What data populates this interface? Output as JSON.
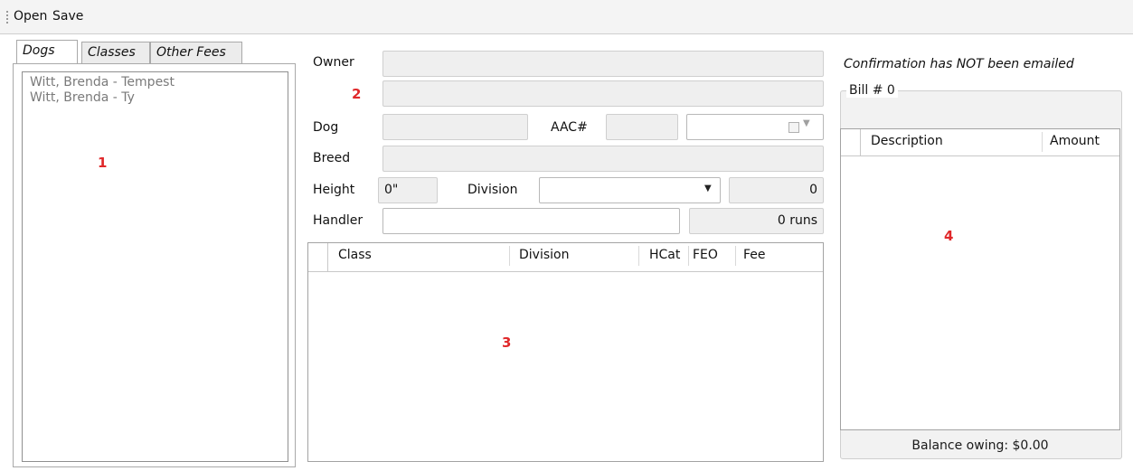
{
  "toolbar": {
    "open_label": "Open",
    "save_label": "Save"
  },
  "tabs": [
    {
      "label": "Dogs",
      "active": true
    },
    {
      "label": "Classes",
      "active": false
    },
    {
      "label": "Other Fees",
      "active": false
    }
  ],
  "dogs": [
    "Witt, Brenda - Tempest",
    "Witt, Brenda - Ty"
  ],
  "markers": [
    "1",
    "2",
    "3",
    "4"
  ],
  "form": {
    "owner_label": "Owner",
    "dog_label": "Dog",
    "aac_label": "AAC#",
    "breed_label": "Breed",
    "height_label": "Height",
    "height_value": "0\"",
    "division_label": "Division",
    "division_count": "0",
    "handler_label": "Handler",
    "runs_value": "0 runs"
  },
  "classes_grid": {
    "columns": [
      "Class",
      "Division",
      "HCat",
      "FEO",
      "Fee"
    ],
    "rows": []
  },
  "bill": {
    "confirmation": "Confirmation has NOT been emailed",
    "bill_number": "Bill # 0",
    "columns": [
      "Description",
      "Amount"
    ],
    "rows": [],
    "balance": "Balance owing: $0.00"
  }
}
